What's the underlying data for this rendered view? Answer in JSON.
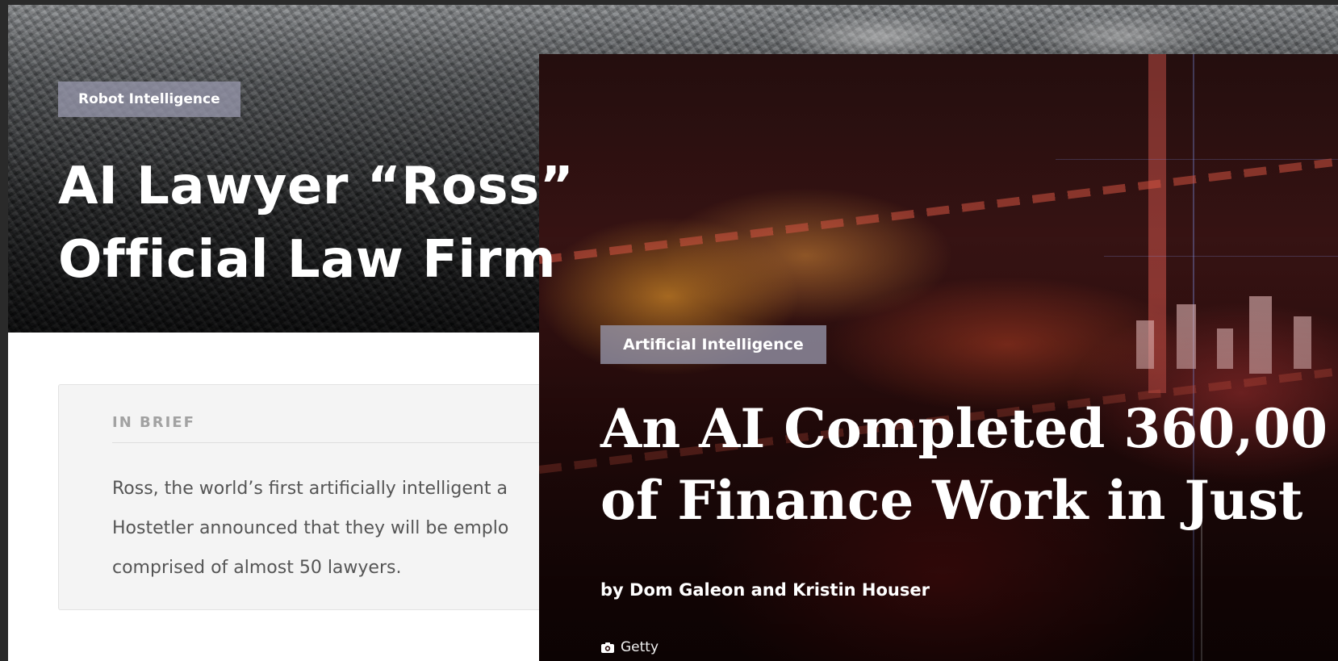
{
  "back_article": {
    "category": "Robot Intelligence",
    "title_line1": "AI Lawyer “Ross”",
    "title_line2": "Official Law Firm",
    "brief_heading": "IN BRIEF",
    "brief_lines": [
      "Ross, the world’s first artificially intelligent a",
      "Hostetler announced that they will be emplo",
      "comprised of almost 50 lawyers."
    ]
  },
  "front_article": {
    "category": "Artificial Intelligence",
    "title_line1": "An AI Completed 360,00",
    "title_line2": "of Finance Work in Just",
    "byline": "by Dom Galeon and Kristin Houser",
    "photo_credit": "Getty",
    "credit_icon": "camera-icon"
  }
}
